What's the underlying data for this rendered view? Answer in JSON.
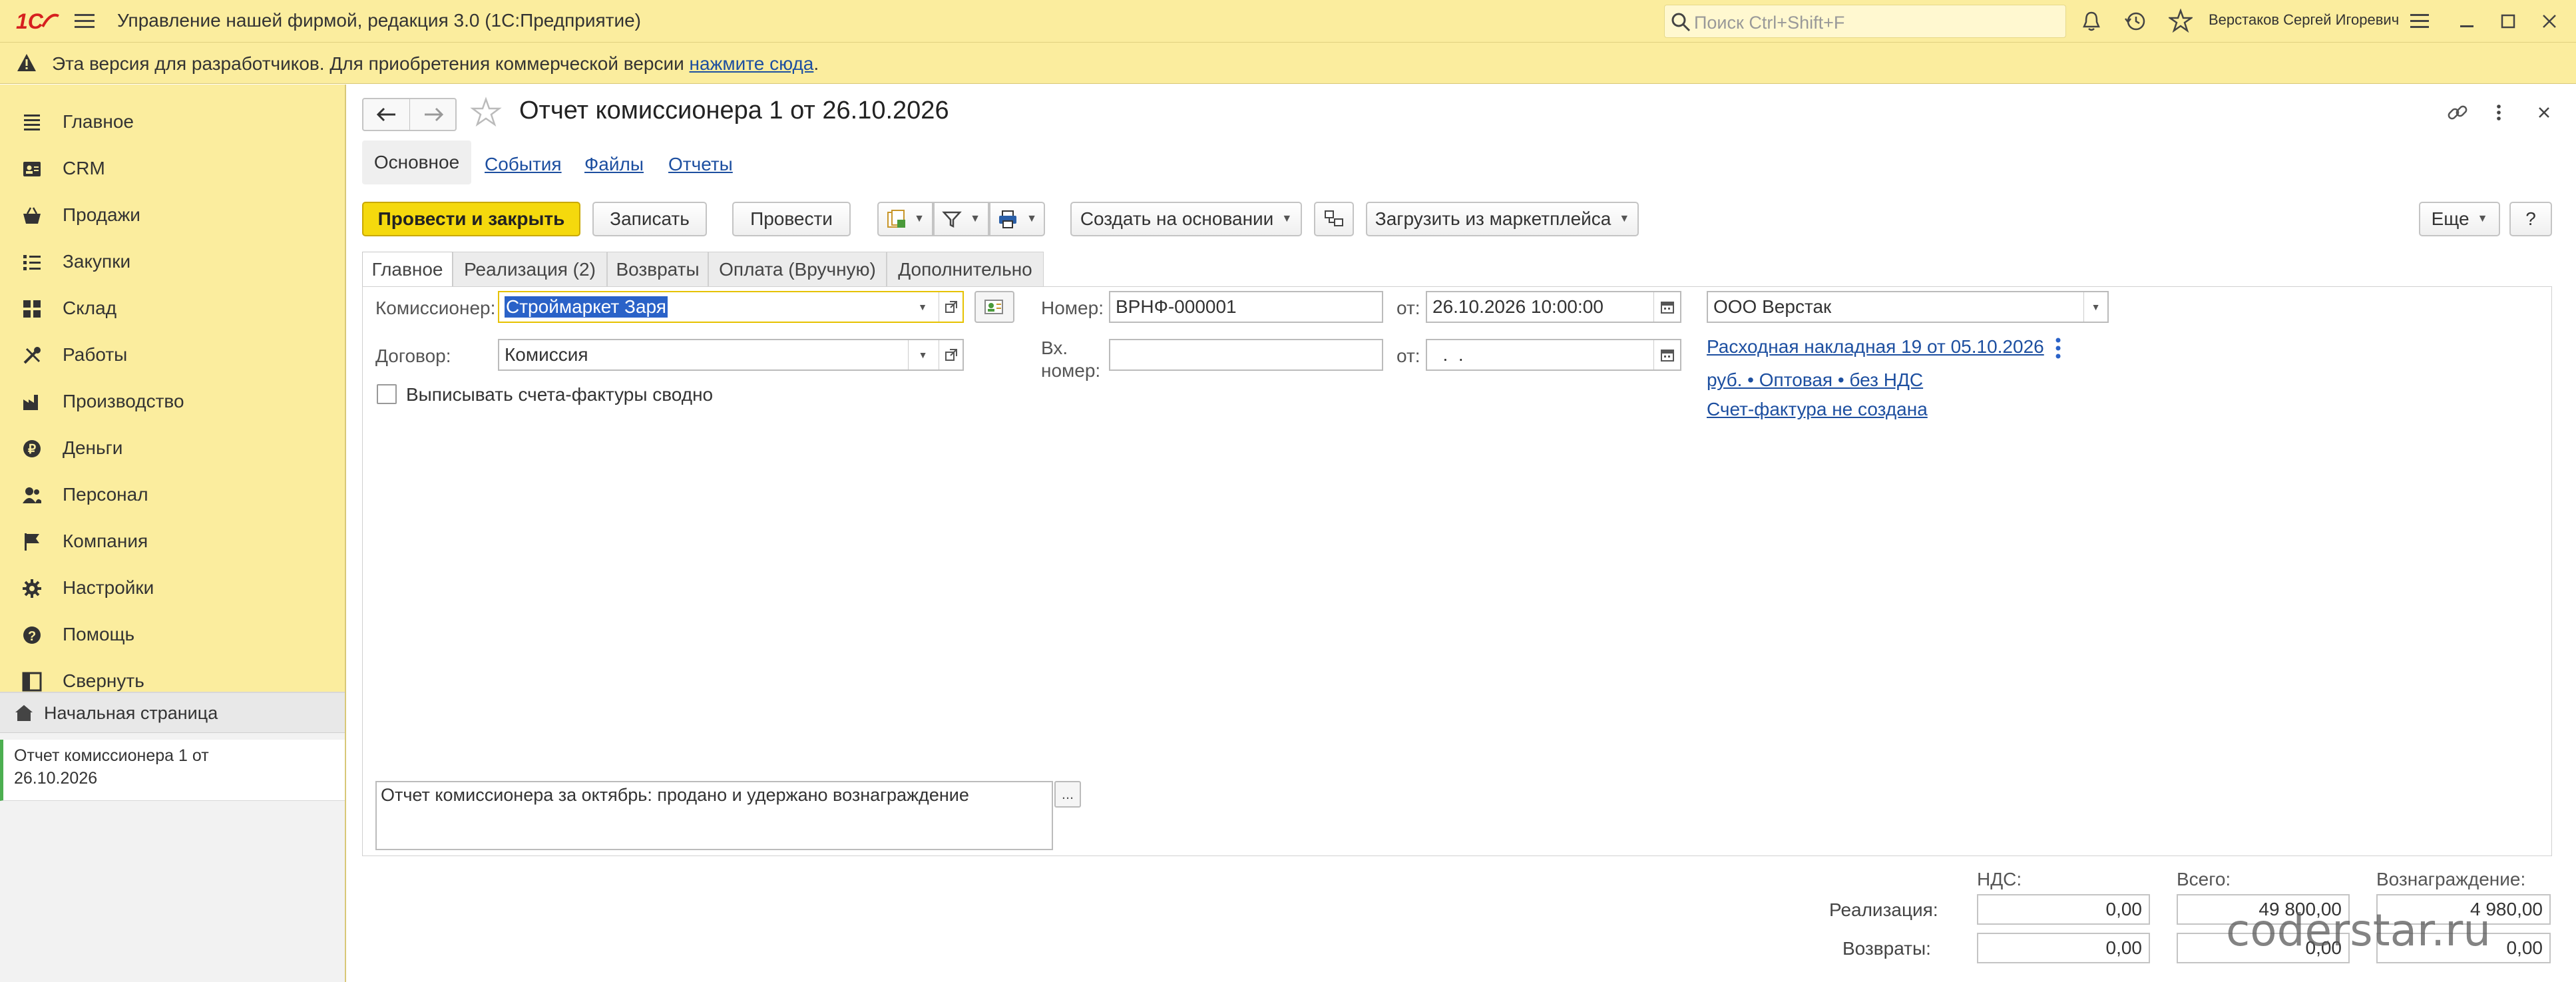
{
  "app": {
    "title": "Управление нашей фирмой, редакция 3.0  (1С:Предприятие)",
    "search_placeholder": "Поиск Ctrl+Shift+F",
    "user": "Верстаков Сергей Игоревич"
  },
  "warning": {
    "text": "Эта версия для разработчиков. Для приобретения коммерческой версии ",
    "link": "нажмите сюда",
    "tail": "."
  },
  "sidebar": {
    "items": [
      {
        "label": "Главное",
        "icon": "menu-lines-icon"
      },
      {
        "label": "CRM",
        "icon": "contact-card-icon"
      },
      {
        "label": "Продажи",
        "icon": "basket-icon"
      },
      {
        "label": "Закупки",
        "icon": "list-checks-icon"
      },
      {
        "label": "Склад",
        "icon": "grid-blocks-icon"
      },
      {
        "label": "Работы",
        "icon": "tools-icon"
      },
      {
        "label": "Производство",
        "icon": "factory-icon"
      },
      {
        "label": "Деньги",
        "icon": "ruble-coin-icon"
      },
      {
        "label": "Персонал",
        "icon": "people-icon"
      },
      {
        "label": "Компания",
        "icon": "flag-icon"
      },
      {
        "label": "Настройки",
        "icon": "gear-icon"
      },
      {
        "label": "Помощь",
        "icon": "help-icon"
      },
      {
        "label": "Свернуть",
        "icon": "collapse-panel-icon"
      }
    ],
    "home": "Начальная страница",
    "open_doc_line1": "Отчет комиссионера 1 от",
    "open_doc_line2": "26.10.2026"
  },
  "doc": {
    "title": "Отчет комиссионера 1 от 26.10.2026",
    "nav_tabs": [
      "Основное",
      "События",
      "Файлы",
      "Отчеты"
    ],
    "toolbar": {
      "post_close": "Провести и закрыть",
      "save": "Записать",
      "post": "Провести",
      "create_based": "Создать на основании",
      "load_marketplace": "Загрузить из маркетплейса",
      "more": "Еще",
      "help": "?"
    },
    "tabs": [
      "Главное",
      "Реализация (2)",
      "Возвраты",
      "Оплата (Вручную)",
      "Дополнительно"
    ],
    "form": {
      "commissioner_label": "Комиссионер:",
      "commissioner_value": "Строймаркет Заря",
      "contract_label": "Договор:",
      "contract_value": "Комиссия",
      "invoice_checkbox": "Выписывать счета-фактуры сводно",
      "number_label": "Номер:",
      "number_value": "ВРНФ-000001",
      "from_label": "от:",
      "date_value": "26.10.2026 10:00:00",
      "in_number_label_1": "Вх.",
      "in_number_label_2": "номер:",
      "in_from_label": "от:",
      "in_date_value": "  .  .",
      "organization": "ООО Верстак",
      "link_invoice": "Расходная накладная 19 от 05.10.2026",
      "link_prices": "руб. • Оптовая • без НДС",
      "link_sf": "Счет-фактура не создана",
      "comment": "Отчет комиссионера за октябрь: продано и удержано вознаграждение",
      "comment_btn": "..."
    },
    "totals": {
      "headers": [
        "НДС:",
        "Всего:",
        "Вознаграждение:"
      ],
      "rows": [
        {
          "label": "Реализация:",
          "vat": "0,00",
          "total": "49 800,00",
          "reward": "4 980,00"
        },
        {
          "label": "Возвраты:",
          "vat": "0,00",
          "total": "0,00",
          "reward": "0,00"
        }
      ]
    }
  },
  "watermark": "coderstar.ru",
  "colors": {
    "panel": "#fbed9e",
    "primary": "#f5d90d",
    "link": "#1d4fa0",
    "accent_green": "#4caf50"
  }
}
